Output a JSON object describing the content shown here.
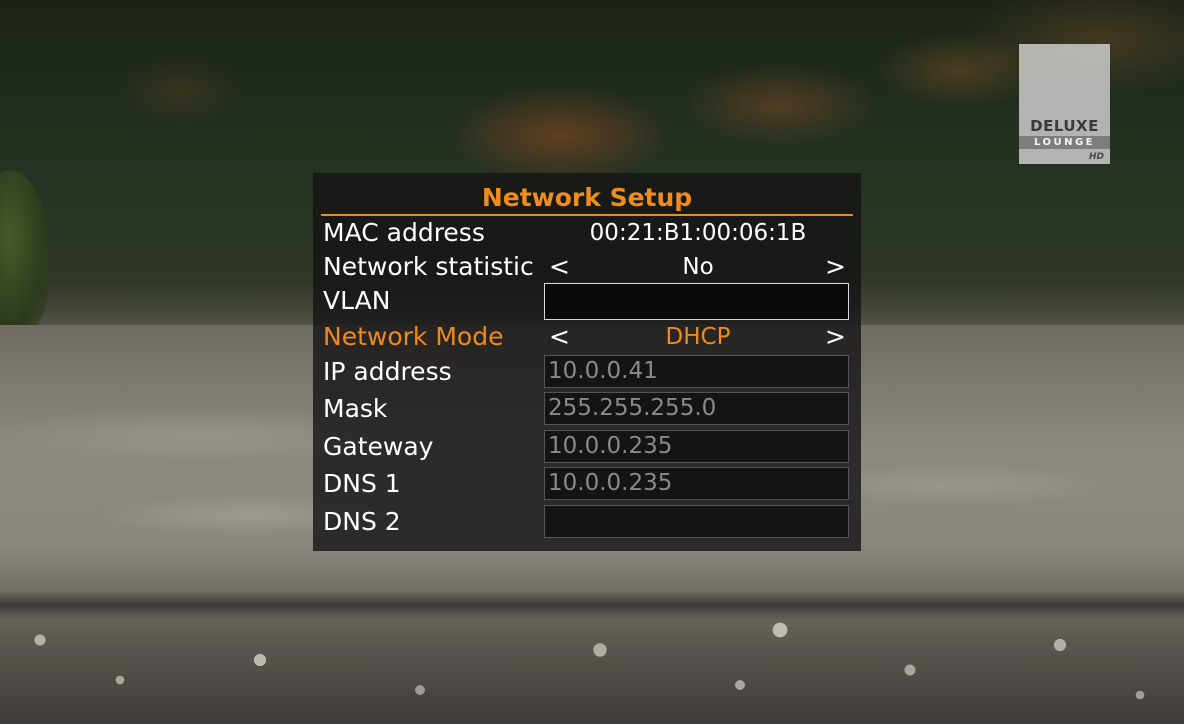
{
  "logo": {
    "line1": "DELUXE",
    "line2": "LOUNGE",
    "line3": "HD"
  },
  "dialog": {
    "title": "Network Setup",
    "mac": {
      "label": "MAC address",
      "value": "00:21:B1:00:06:1B"
    },
    "statistic": {
      "label": "Network statistic",
      "value": "No",
      "left_arrow": "<",
      "right_arrow": ">"
    },
    "vlan": {
      "label": "VLAN",
      "value": ""
    },
    "mode": {
      "label": "Network Mode",
      "value": "DHCP",
      "left_arrow": "<",
      "right_arrow": ">"
    },
    "ip": {
      "label": "IP address",
      "value": "10.0.0.41"
    },
    "mask": {
      "label": "Mask",
      "value": "255.255.255.0"
    },
    "gateway": {
      "label": "Gateway",
      "value": "10.0.0.235"
    },
    "dns1": {
      "label": "DNS 1",
      "value": "10.0.0.235"
    },
    "dns2": {
      "label": "DNS 2",
      "value": ""
    }
  },
  "colors": {
    "accent": "#ef8a1c",
    "text": "#ffffff",
    "disabled_text": "#8a8a8a",
    "panel_bg": "#141414"
  }
}
